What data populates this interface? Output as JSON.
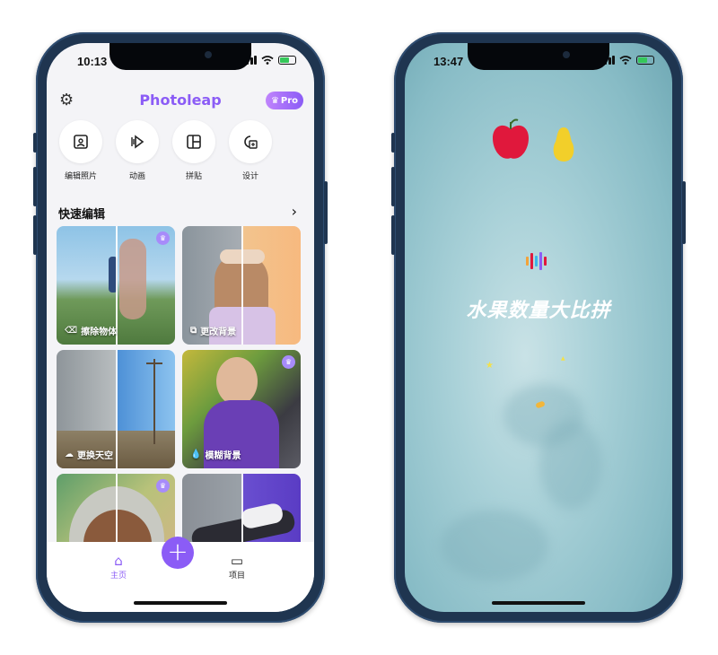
{
  "left_phone": {
    "status_time": "10:13",
    "app_title": "Photoleap",
    "pro_badge": "Pro",
    "tools": [
      {
        "label": "编辑照片",
        "icon": "photo-icon"
      },
      {
        "label": "动画",
        "icon": "animate-icon"
      },
      {
        "label": "拼贴",
        "icon": "collage-icon"
      },
      {
        "label": "设计",
        "icon": "design-icon"
      }
    ],
    "quick_edit_title": "快速编辑",
    "cards": [
      {
        "label": "擦除物体",
        "icon": "eraser-icon",
        "premium": true
      },
      {
        "label": "更改背景",
        "icon": "layers-icon",
        "premium": false
      },
      {
        "label": "更换天空",
        "icon": "cloud-icon",
        "premium": false
      },
      {
        "label": "模糊背景",
        "icon": "drop-icon",
        "premium": true
      },
      {
        "label": "",
        "icon": "",
        "premium": true
      },
      {
        "label": "",
        "icon": "",
        "premium": false
      }
    ],
    "tabs": [
      {
        "label": "主页",
        "icon": "home-icon"
      },
      {
        "label": "项目",
        "icon": "folder-icon"
      }
    ],
    "accent_color": "#8b5cf6"
  },
  "right_phone": {
    "status_time": "13:47",
    "game_title": "水果数量大比拼",
    "fruits": [
      "apple",
      "pear"
    ]
  }
}
